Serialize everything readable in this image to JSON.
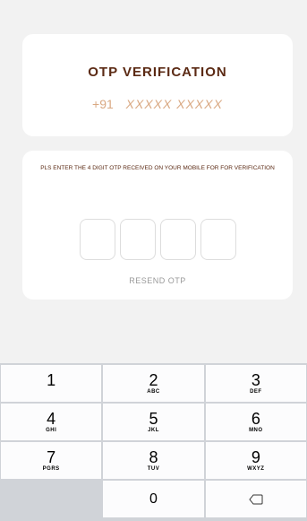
{
  "header": {
    "title": "OTP VERIFICATION",
    "country_code": "+91",
    "phone_masked": "XXXXX XXXXX"
  },
  "otp": {
    "instruction": "PLS ENTER THE 4 DIGIT OTP RECEIVED ON YOUR MOBILE FOR FOR VERIFICATION",
    "digits": [
      "",
      "",
      "",
      ""
    ],
    "resend_label": "RESEND OTP"
  },
  "keypad": {
    "keys": [
      {
        "digit": "1",
        "letters": ""
      },
      {
        "digit": "2",
        "letters": "ABC"
      },
      {
        "digit": "3",
        "letters": "DEF"
      },
      {
        "digit": "4",
        "letters": "GHI"
      },
      {
        "digit": "5",
        "letters": "JKL"
      },
      {
        "digit": "6",
        "letters": "MNO"
      },
      {
        "digit": "7",
        "letters": "PGRS"
      },
      {
        "digit": "8",
        "letters": "TUV"
      },
      {
        "digit": "9",
        "letters": "WXYZ"
      },
      {
        "digit": "0",
        "letters": ""
      }
    ],
    "backspace_icon": "backspace-icon"
  },
  "colors": {
    "title": "#5b2a14",
    "phone": "#d9a882",
    "background": "#f2f2f2"
  }
}
